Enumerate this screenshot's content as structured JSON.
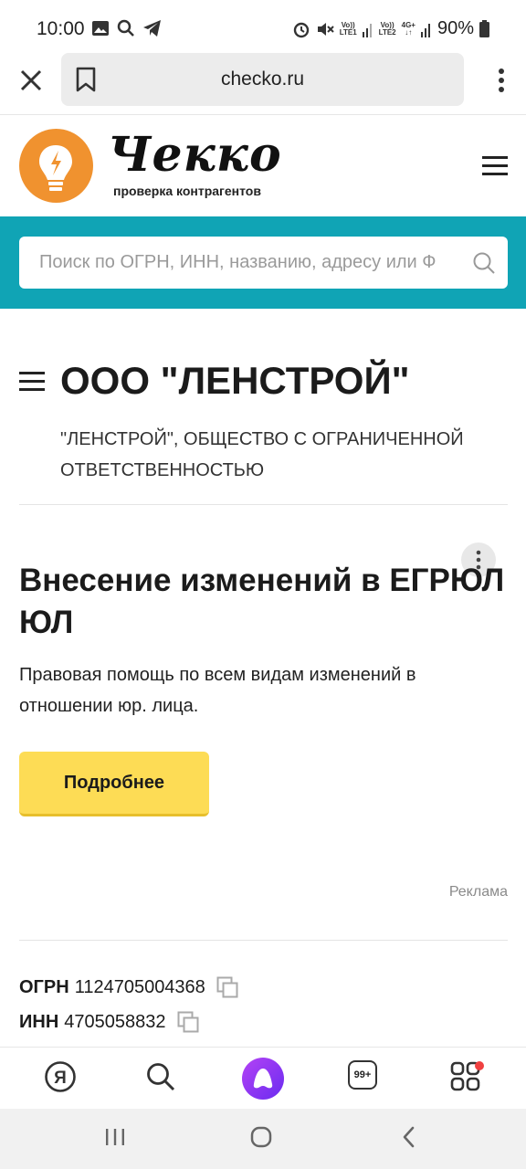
{
  "status_bar": {
    "time": "10:00",
    "battery": "90%",
    "sim1": "LTE1",
    "sim2": "LTE2",
    "network": "4G+",
    "volte": "Vo))"
  },
  "browser": {
    "url": "checko.ru"
  },
  "site": {
    "logo_word": "Чекко",
    "logo_subtitle": "проверка контрагентов",
    "search_placeholder": "Поиск по ОГРН, ИНН, названию, адресу или Ф"
  },
  "company": {
    "title": "ООО \"ЛЕНСТРОЙ\"",
    "full_name": "\"ЛЕНСТРОЙ\", ОБЩЕСТВО С ОГРАНИЧЕННОЙ ОТВЕТСТВЕННОСТЬЮ"
  },
  "ad": {
    "title": "Внесение изменений в ЕГРЮЛ ЮЛ",
    "text": "Правовая помощь по всем видам изменений в отношении юр. лица.",
    "button": "Подробнее",
    "label": "Реклама"
  },
  "registration": {
    "ogrn_label": "ОГРН",
    "ogrn_value": "1124705004368",
    "inn_label": "ИНН",
    "inn_value": "4705058832"
  },
  "bottom_nav": {
    "yandex_letter": "Я",
    "tabs_count": "99+"
  },
  "colors": {
    "accent_teal": "#10a4b5",
    "button_yellow": "#fddc55",
    "logo_orange": "#f0922f",
    "alice_purple": "#8a3cf0"
  }
}
